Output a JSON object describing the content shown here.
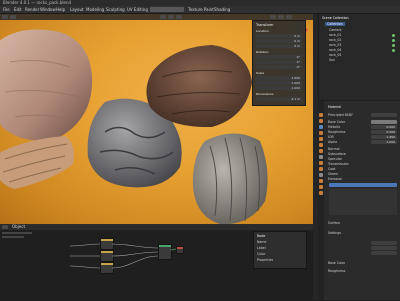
{
  "window": {
    "title": "Blender 4.0.1 — rocks_pack.blend"
  },
  "menubar": {
    "items": [
      "File",
      "Edit",
      "Render",
      "Window",
      "Help",
      "Layout",
      "Modeling",
      "Sculpting",
      "UV Editing",
      "Texture Paint",
      "Shading"
    ]
  },
  "viewport": {
    "background_color": "#e7a132",
    "npanel": {
      "sections": [
        "Transform",
        "Location",
        "Rotation",
        "Scale",
        "Dimensions"
      ],
      "values": [
        "0 m",
        "0 m",
        "0 m",
        "0°",
        "0°",
        "0°",
        "1.000",
        "1.000",
        "1.000",
        "2.1 m",
        "1.5 m",
        "1.2 m"
      ]
    }
  },
  "outliner": {
    "title": "Scene Collection",
    "rows": [
      {
        "label": "Scene Collection",
        "selected": false
      },
      {
        "label": "Collection",
        "selected": true
      },
      {
        "label": "Camera",
        "selected": false
      },
      {
        "label": "rock_01",
        "selected": false
      },
      {
        "label": "rock_02",
        "selected": false
      },
      {
        "label": "rock_03",
        "selected": false
      },
      {
        "label": "rock_04",
        "selected": false
      },
      {
        "label": "rock_05",
        "selected": false
      },
      {
        "label": "Sun",
        "selected": false
      }
    ]
  },
  "properties": {
    "sections": [
      "Material",
      "Surface",
      "Settings",
      "Base Color",
      "Roughness",
      "Normal"
    ],
    "rows": [
      {
        "label": "Principled BSDF",
        "value": ""
      },
      {
        "label": "Base Color",
        "value": ""
      },
      {
        "label": "Metallic",
        "value": "0.000"
      },
      {
        "label": "Roughness",
        "value": "0.500"
      },
      {
        "label": "IOR",
        "value": "1.450"
      },
      {
        "label": "Alpha",
        "value": "1.000"
      },
      {
        "label": "Normal",
        "value": ""
      },
      {
        "label": "Subsurface",
        "value": ""
      },
      {
        "label": "Specular",
        "value": ""
      },
      {
        "label": "Transmission",
        "value": ""
      },
      {
        "label": "Coat",
        "value": ""
      },
      {
        "label": "Sheen",
        "value": ""
      },
      {
        "label": "Emission",
        "value": ""
      }
    ],
    "tab_colors": [
      "#c67c3a",
      "#c67c3a",
      "#5a8ac6",
      "#c67c3a",
      "#c67c3a",
      "#c67c3a",
      "#c67c3a",
      "#8a8a8a",
      "#c67c3a",
      "#c67c3a",
      "#8a8a8a",
      "#c67c3a",
      "#c67c3a",
      "#c67c3a"
    ]
  },
  "node_editor": {
    "header_label": "Object",
    "side_panel": {
      "rows": [
        "Node",
        "Name",
        "Label",
        "Color",
        "Properties"
      ]
    },
    "nodes": [
      "Image Texture",
      "Image Texture",
      "Image Texture",
      "Principled BSDF",
      "Material Output"
    ]
  }
}
